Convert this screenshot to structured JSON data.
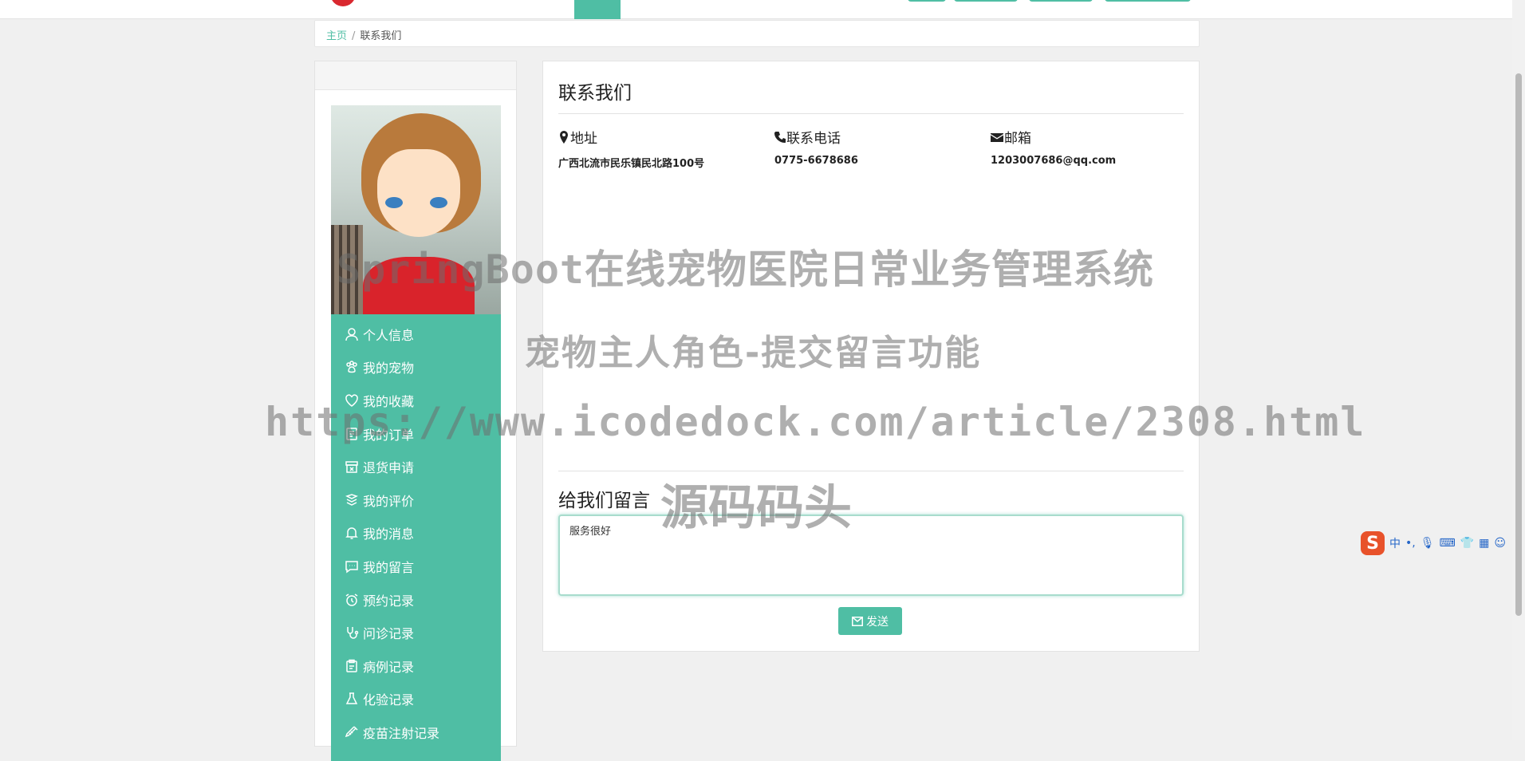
{
  "breadcrumb": {
    "home": "主页",
    "separator": "/",
    "current": "联系我们"
  },
  "sidebar": {
    "items": [
      {
        "label": "个人信息",
        "icon": "user-icon"
      },
      {
        "label": "我的宠物",
        "icon": "paw-icon"
      },
      {
        "label": "我的收藏",
        "icon": "heart-icon"
      },
      {
        "label": "我的订单",
        "icon": "order-icon"
      },
      {
        "label": "退货申请",
        "icon": "return-box-icon"
      },
      {
        "label": "我的评价",
        "icon": "review-icon"
      },
      {
        "label": "我的消息",
        "icon": "bell-icon"
      },
      {
        "label": "我的留言",
        "icon": "comment-icon"
      },
      {
        "label": "预约记录",
        "icon": "alarm-clock-icon"
      },
      {
        "label": "问诊记录",
        "icon": "stethoscope-icon"
      },
      {
        "label": "病例记录",
        "icon": "clipboard-icon"
      },
      {
        "label": "化验记录",
        "icon": "flask-icon"
      },
      {
        "label": "疫苗注射记录",
        "icon": "syringe-icon"
      }
    ]
  },
  "contact": {
    "title": "联系我们",
    "address_label": "地址",
    "address_value": "广西北流市民乐镇民北路100号",
    "phone_label": "联系电话",
    "phone_value": "0775-6678686",
    "email_label": "邮箱",
    "email_value": "1203007686@qq.com"
  },
  "message": {
    "title": "给我们留言",
    "text": "服务很好",
    "send_label": "发送"
  },
  "watermark": {
    "line1": "SpringBoot在线宠物医院日常业务管理系统",
    "line2": "宠物主人角色-提交留言功能",
    "line3": "https://www.icodedock.com/article/2308.html",
    "line4": "源码码头"
  },
  "ime": {
    "lang": "中",
    "punct": "•,"
  }
}
